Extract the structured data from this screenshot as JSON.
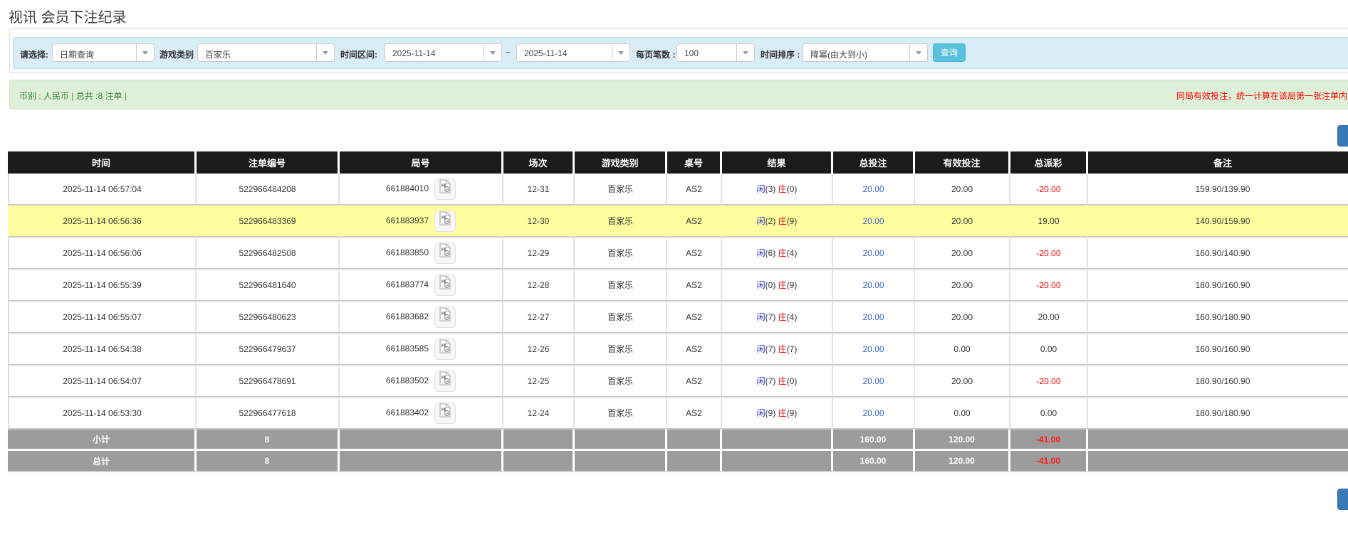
{
  "title": "视讯 会员下注纪录",
  "filters": {
    "select_label": "请选择:",
    "select_value": "日期查询",
    "game_type_label": "游戏类别",
    "game_type_value": "百家乐",
    "time_range_label": "时间区间:",
    "time_from": "2025-11-14",
    "tilde": "~",
    "time_to": "2025-11-14",
    "page_size_label": "每页笔数 :",
    "page_size_value": "100",
    "sort_label": "时间排序 :",
    "sort_value": "降幂(由大到小)",
    "search_button": "查询"
  },
  "summary": {
    "left_text": "币别 : 人民币 | 总共 :8 注单 |",
    "right_notice": "同局有效投注，统一计算在该局第一张注单内"
  },
  "table": {
    "headers": [
      "时间",
      "注单编号",
      "局号",
      "场次",
      "游戏类别",
      "桌号",
      "结果",
      "总投注",
      "有效投注",
      "总派彩",
      "备注"
    ],
    "rows": [
      {
        "time": "2025-11-14 06:57:04",
        "bet_id": "522966484208",
        "round_id": "661884010",
        "session": "12-31",
        "game": "百家乐",
        "table_no": "AS2",
        "player": "闲",
        "player_n": "(3)",
        "banker": "庄",
        "banker_n": "(0)",
        "total_bet": "20.00",
        "valid_bet": "20.00",
        "payout": "-20.00",
        "remark": "159.90/139.90",
        "highlight": false
      },
      {
        "time": "2025-11-14 06:56:36",
        "bet_id": "522966483369",
        "round_id": "661883937",
        "session": "12-30",
        "game": "百家乐",
        "table_no": "AS2",
        "player": "闲",
        "player_n": "(2)",
        "banker": "庄",
        "banker_n": "(9)",
        "total_bet": "20.00",
        "valid_bet": "20.00",
        "payout": "19.00",
        "remark": "140.90/159.90",
        "highlight": true
      },
      {
        "time": "2025-11-14 06:56:06",
        "bet_id": "522966482508",
        "round_id": "661883850",
        "session": "12-29",
        "game": "百家乐",
        "table_no": "AS2",
        "player": "闲",
        "player_n": "(6)",
        "banker": "庄",
        "banker_n": "(4)",
        "total_bet": "20.00",
        "valid_bet": "20.00",
        "payout": "-20.00",
        "remark": "160.90/140.90",
        "highlight": false
      },
      {
        "time": "2025-11-14 06:55:39",
        "bet_id": "522966481640",
        "round_id": "661883774",
        "session": "12-28",
        "game": "百家乐",
        "table_no": "AS2",
        "player": "闲",
        "player_n": "(0)",
        "banker": "庄",
        "banker_n": "(9)",
        "total_bet": "20.00",
        "valid_bet": "20.00",
        "payout": "-20.00",
        "remark": "180.90/160.90",
        "highlight": false
      },
      {
        "time": "2025-11-14 06:55:07",
        "bet_id": "522966480623",
        "round_id": "661883682",
        "session": "12-27",
        "game": "百家乐",
        "table_no": "AS2",
        "player": "闲",
        "player_n": "(7)",
        "banker": "庄",
        "banker_n": "(4)",
        "total_bet": "20.00",
        "valid_bet": "20.00",
        "payout": "20.00",
        "remark": "160.90/180.90",
        "highlight": false
      },
      {
        "time": "2025-11-14 06:54:38",
        "bet_id": "522966479637",
        "round_id": "661883585",
        "session": "12-26",
        "game": "百家乐",
        "table_no": "AS2",
        "player": "闲",
        "player_n": "(7)",
        "banker": "庄",
        "banker_n": "(7)",
        "total_bet": "20.00",
        "valid_bet": "0.00",
        "payout": "0.00",
        "remark": "160.90/160.90",
        "highlight": false
      },
      {
        "time": "2025-11-14 06:54:07",
        "bet_id": "522966478691",
        "round_id": "661883502",
        "session": "12-25",
        "game": "百家乐",
        "table_no": "AS2",
        "player": "闲",
        "player_n": "(7)",
        "banker": "庄",
        "banker_n": "(0)",
        "total_bet": "20.00",
        "valid_bet": "20.00",
        "payout": "-20.00",
        "remark": "180.90/160.90",
        "highlight": false
      },
      {
        "time": "2025-11-14 06:53:30",
        "bet_id": "522966477618",
        "round_id": "661883402",
        "session": "12-24",
        "game": "百家乐",
        "table_no": "AS2",
        "player": "闲",
        "player_n": "(9)",
        "banker": "庄",
        "banker_n": "(9)",
        "total_bet": "20.00",
        "valid_bet": "0.00",
        "payout": "0.00",
        "remark": "180.90/180.90",
        "highlight": false
      }
    ],
    "subtotal": {
      "label": "小计",
      "count": "8",
      "total_bet": "160.00",
      "valid_bet": "120.00",
      "payout": "-41.00"
    },
    "grand_total": {
      "label": "总计",
      "count": "8",
      "total_bet": "160.00",
      "valid_bet": "120.00",
      "payout": "-41.00"
    }
  },
  "colors": {
    "accent_blue_bar": "#d9edf7",
    "accent_green_bar": "#dff0d8",
    "header_bg": "#1b1b1b",
    "highlight_row": "#ffffa0",
    "total_row_bg": "#9c9c9c",
    "bet_blue": "#3366cc",
    "loss_red": "#f00000",
    "player_blue": "#2d2ddd",
    "banker_red": "#e60000",
    "search_button_bg": "#5bc0de"
  }
}
